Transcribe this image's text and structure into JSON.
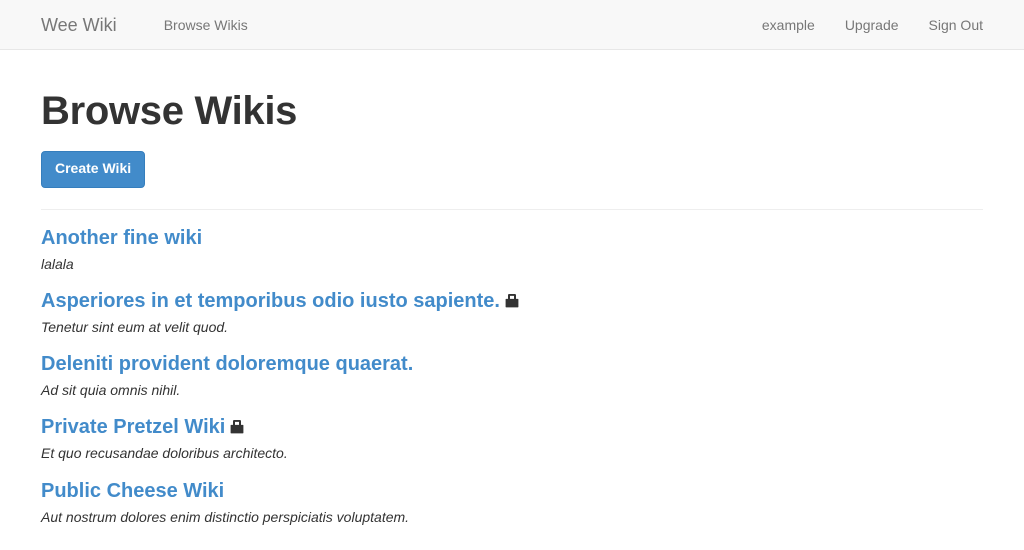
{
  "navbar": {
    "brand": "Wee Wiki",
    "left_links": [
      {
        "label": "Browse Wikis",
        "name": "nav-link-browse-wikis"
      }
    ],
    "right_links": [
      {
        "label": "example",
        "name": "nav-link-example"
      },
      {
        "label": "Upgrade",
        "name": "nav-link-upgrade"
      },
      {
        "label": "Sign Out",
        "name": "nav-link-sign-out"
      }
    ],
    "background": "#f8f8f8",
    "link_color": "#777777"
  },
  "main": {
    "page_title": "Browse Wikis",
    "create_button_label": "Create Wiki",
    "accent_color": "#428bca"
  },
  "wikis": [
    {
      "title": "Another fine wiki",
      "description": "lalala",
      "private": false,
      "lock_icon": ""
    },
    {
      "title": "Asperiores in et temporibus odio iusto sapiente.",
      "description": "Tenetur sint eum at velit quod.",
      "private": true,
      "lock_icon": "lock-icon"
    },
    {
      "title": "Deleniti provident doloremque quaerat.",
      "description": "Ad sit quia omnis nihil.",
      "private": false,
      "lock_icon": ""
    },
    {
      "title": "Private Pretzel Wiki",
      "description": "Et quo recusandae doloribus architecto.",
      "private": true,
      "lock_icon": "lock-icon"
    },
    {
      "title": "Public Cheese Wiki",
      "description": "Aut nostrum dolores enim distinctio perspiciatis voluptatem.",
      "private": false,
      "lock_icon": ""
    }
  ]
}
